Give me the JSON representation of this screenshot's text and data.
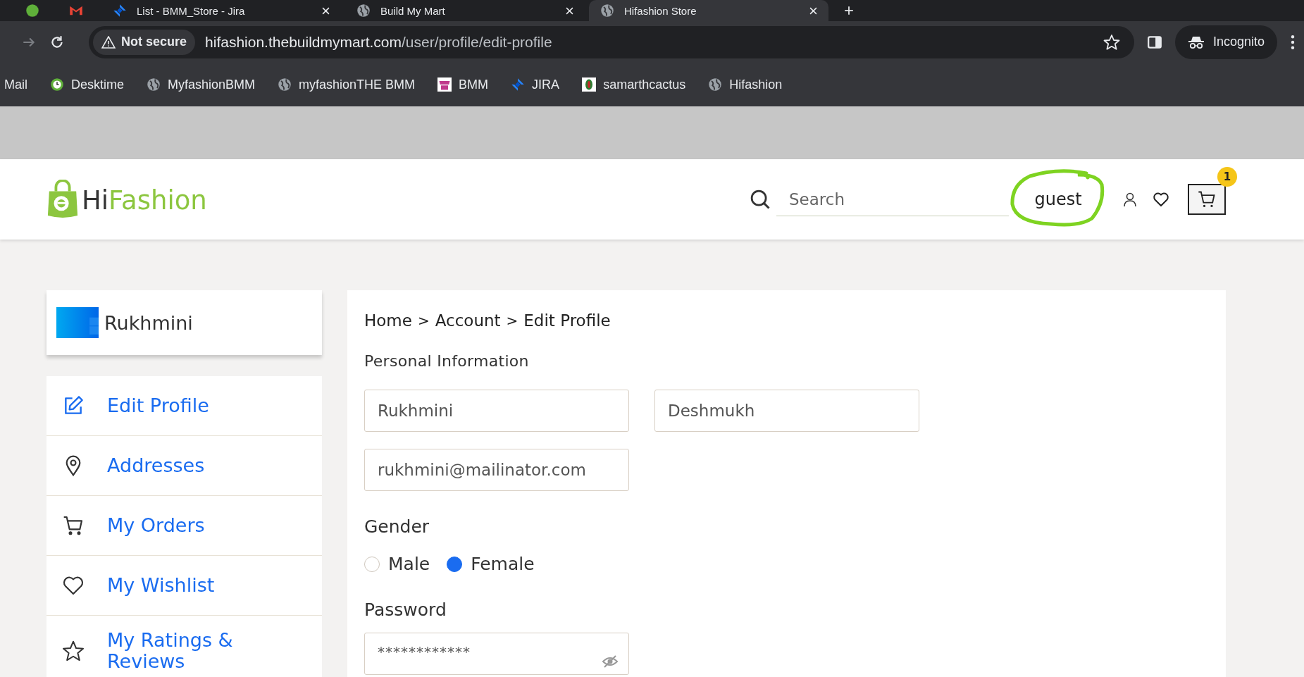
{
  "browser": {
    "tabs": [
      {
        "kind": "green-dot",
        "selected": false
      },
      {
        "kind": "mail",
        "selected": false
      },
      {
        "title": "List - BMM_Store - Jira",
        "kind": "jira",
        "selected": false
      },
      {
        "title": "Build My Mart",
        "kind": "globe",
        "selected": false
      },
      {
        "title": "Hifashion Store",
        "kind": "globe",
        "selected": true
      }
    ],
    "security": "Not secure",
    "url_host": "hifashion.thebuildmymart.com",
    "url_path": "/user/profile/edit-profile",
    "incognito": "Incognito",
    "bookmarks": [
      {
        "label": "Mail",
        "kind": "plain"
      },
      {
        "label": "Desktime",
        "kind": "desktime"
      },
      {
        "label": "MyfashionBMM",
        "kind": "globe"
      },
      {
        "label": "myfashionTHE BMM",
        "kind": "globe"
      },
      {
        "label": "BMM",
        "kind": "bmm"
      },
      {
        "label": "JIRA",
        "kind": "jira"
      },
      {
        "label": "samarthcactus",
        "kind": "cactus"
      },
      {
        "label": "Hifashion",
        "kind": "globe"
      }
    ]
  },
  "header": {
    "logo_first": "Hi",
    "logo_second": "Fashion",
    "search_placeholder": "Search",
    "user": "guest",
    "cart_count": "1"
  },
  "sidebar": {
    "profile_name": "Rukhmini",
    "items": [
      {
        "label": "Edit Profile",
        "kind": "edit",
        "selected": true
      },
      {
        "label": "Addresses",
        "kind": "pin",
        "selected": false
      },
      {
        "label": "My Orders",
        "kind": "cart",
        "selected": false
      },
      {
        "label": "My Wishlist",
        "kind": "heart",
        "selected": false
      },
      {
        "label": "My Ratings & Reviews",
        "kind": "star",
        "selected": false
      }
    ]
  },
  "main": {
    "breadcrumb": [
      "Home",
      "Account",
      "Edit Profile"
    ],
    "separator": ">",
    "section_title": "Personal Information",
    "first_name": "Rukhmini",
    "last_name": "Deshmukh",
    "email": "rukhmini@mailinator.com",
    "gender_label": "Gender",
    "gender_options": [
      {
        "label": "Male",
        "selected": false
      },
      {
        "label": "Female",
        "selected": true
      }
    ],
    "password_label": "Password",
    "password": "************"
  }
}
